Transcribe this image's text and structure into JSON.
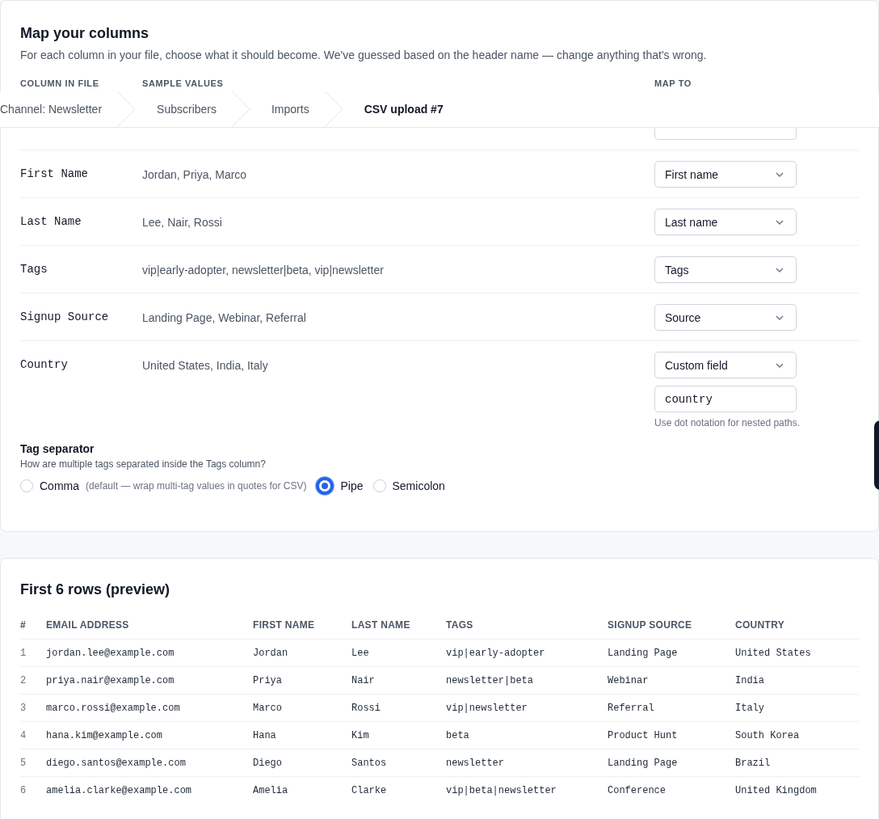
{
  "breadcrumb": [
    {
      "label": "Channel: Newsletter",
      "current": false
    },
    {
      "label": "Subscribers",
      "current": false
    },
    {
      "label": "Imports",
      "current": false
    },
    {
      "label": "CSV upload #7",
      "current": true
    }
  ],
  "mapping": {
    "title": "Map your columns",
    "description": "For each column in your file, choose what it should become. We've guessed based on the header name — change anything that's wrong.",
    "headers": [
      "COLUMN IN FILE",
      "SAMPLE VALUES",
      "MAP TO"
    ],
    "rows": [
      {
        "covered": true
      },
      {
        "column": "First Name",
        "samples": "Jordan, Priya, Marco",
        "map_to": "First name"
      },
      {
        "column": "Last Name",
        "samples": "Lee, Nair, Rossi",
        "map_to": "Last name"
      },
      {
        "column": "Tags",
        "samples": "vip|early-adopter, newsletter|beta, vip|newsletter",
        "map_to": "Tags"
      },
      {
        "column": "Signup Source",
        "samples": "Landing Page, Webinar, Referral",
        "map_to": "Source"
      },
      {
        "column": "Country",
        "samples": "United States, India, Italy",
        "map_to": "Custom field",
        "custom_value": "country",
        "hint": "Use dot notation for nested paths."
      }
    ],
    "separator": {
      "title": "Tag separator",
      "description": "How are multiple tags separated inside the Tags column?",
      "options": [
        {
          "label": "Comma",
          "note": "(default — wrap multi-tag values in quotes for CSV)",
          "selected": false
        },
        {
          "label": "Pipe",
          "selected": true
        },
        {
          "label": "Semicolon",
          "selected": false
        }
      ]
    }
  },
  "preview": {
    "title": "First 6 rows (preview)",
    "columns": [
      "#",
      "EMAIL ADDRESS",
      "FIRST NAME",
      "LAST NAME",
      "TAGS",
      "SIGNUP SOURCE",
      "COUNTRY"
    ],
    "rows": [
      [
        "1",
        "jordan.lee@example.com",
        "Jordan",
        "Lee",
        "vip|early-adopter",
        "Landing Page",
        "United States"
      ],
      [
        "2",
        "priya.nair@example.com",
        "Priya",
        "Nair",
        "newsletter|beta",
        "Webinar",
        "India"
      ],
      [
        "3",
        "marco.rossi@example.com",
        "Marco",
        "Rossi",
        "vip|newsletter",
        "Referral",
        "Italy"
      ],
      [
        "4",
        "hana.kim@example.com",
        "Hana",
        "Kim",
        "beta",
        "Product Hunt",
        "South Korea"
      ],
      [
        "5",
        "diego.santos@example.com",
        "Diego",
        "Santos",
        "newsletter",
        "Landing Page",
        "Brazil"
      ],
      [
        "6",
        "amelia.clarke@example.com",
        "Amelia",
        "Clarke",
        "vip|beta|newsletter",
        "Conference",
        "United Kingdom"
      ]
    ]
  }
}
